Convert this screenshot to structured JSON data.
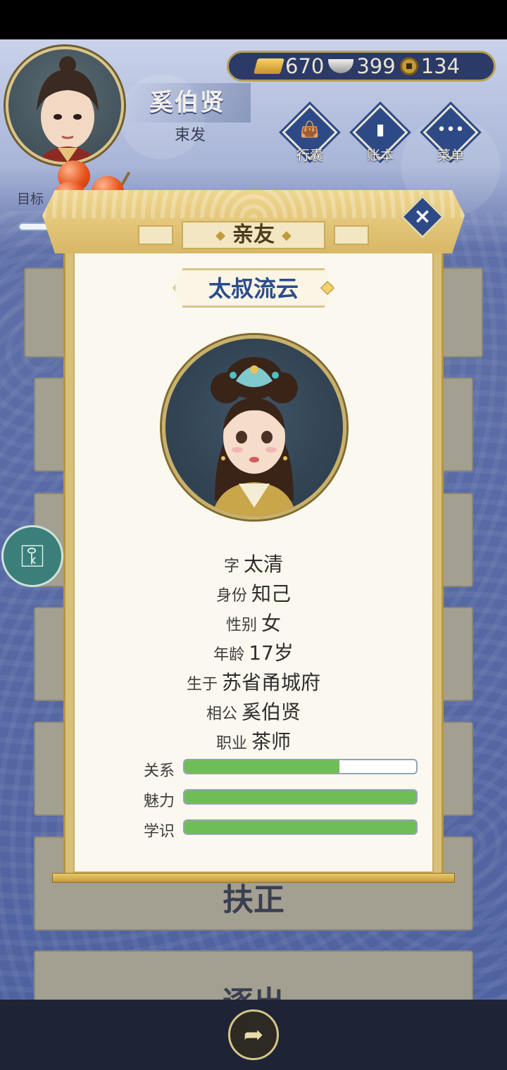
{
  "player": {
    "name": "奚伯贤",
    "style": "束发"
  },
  "currency": {
    "gold": "670",
    "silver": "399",
    "coins": "134"
  },
  "menu": {
    "bag": "行囊",
    "ledger": "账本",
    "menu": "菜单"
  },
  "goal_label": "目标",
  "background_cards": {
    "card5_label": "扶正",
    "card6_label": "逐出"
  },
  "modal": {
    "title": "亲友",
    "character_name": "太叔流云",
    "info": [
      {
        "label": "字",
        "value": "太清"
      },
      {
        "label": "身份",
        "value": "知己"
      },
      {
        "label": "性别",
        "value": "女"
      },
      {
        "label": "年龄",
        "value": "17岁"
      },
      {
        "label": "生于",
        "value": "苏省甬城府"
      },
      {
        "label": "相公",
        "value": "奚伯贤"
      },
      {
        "label": "职业",
        "value": "茶师"
      }
    ],
    "stats": [
      {
        "label": "关系",
        "value": 0.67
      },
      {
        "label": "魅力",
        "value": 1.0
      },
      {
        "label": "学识",
        "value": 1.0
      }
    ]
  },
  "colors": {
    "stat_fill": "#6fbd56",
    "name_blue": "#2b4c8a",
    "menu_blue": "#2d4a86"
  },
  "icons": {
    "share": "share-arrow-icon",
    "key": "key-lock-icon",
    "close": "close-icon"
  }
}
